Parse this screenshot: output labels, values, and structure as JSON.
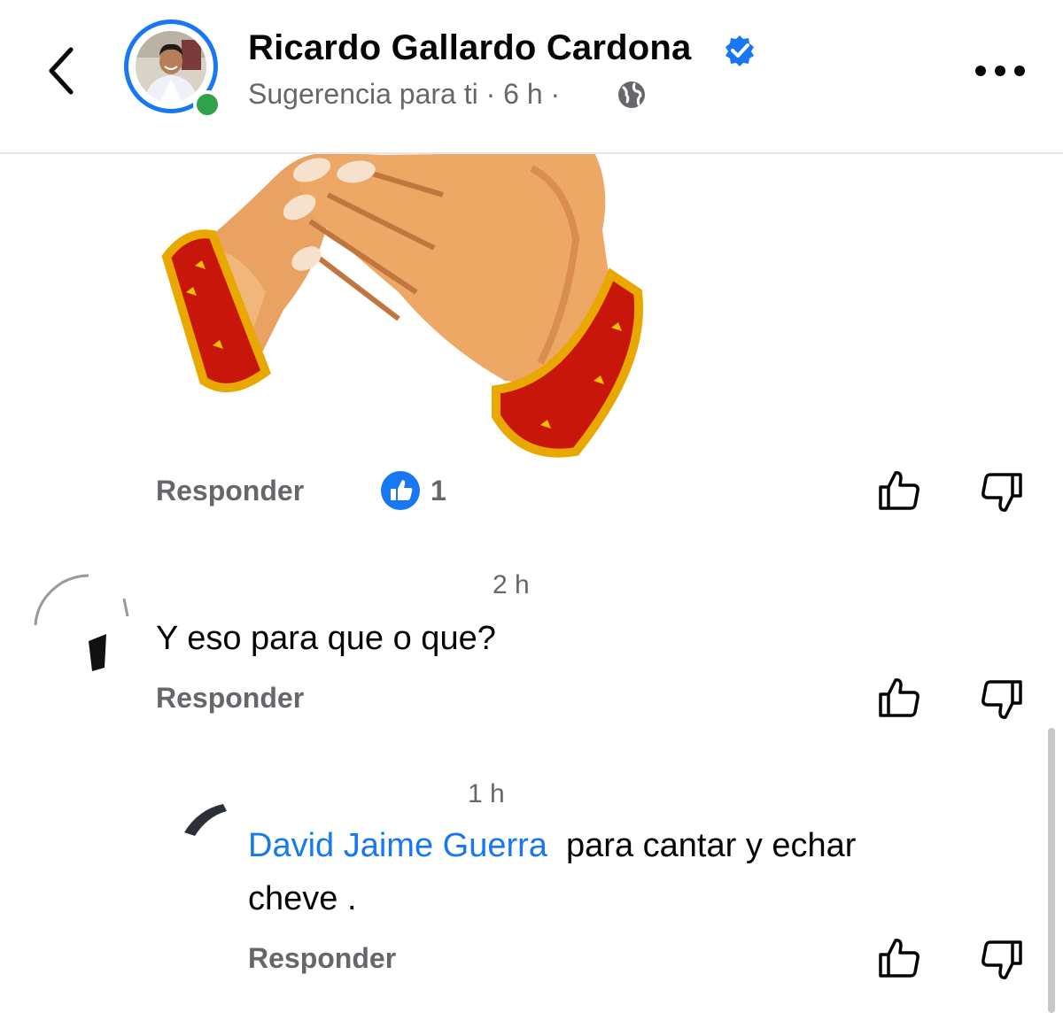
{
  "header": {
    "title": "Ricardo Gallardo Cardona",
    "subtitle_parts": [
      "Sugerencia para ti",
      "·",
      "6 h",
      "·"
    ]
  },
  "post": {
    "reply_label": "Responder",
    "reaction_count": "1"
  },
  "comments": [
    {
      "time": "2 h",
      "text": "Y eso para que o que?",
      "reply_label": "Responder"
    },
    {
      "time": "1 h",
      "mention": "David Jaime Guerra",
      "text": "para cantar y echar",
      "text_line2": "cheve .",
      "reply_label": "Responder"
    }
  ],
  "colors": {
    "accent": "#1877f2",
    "secondary_text": "#65676b",
    "online": "#31a24c"
  },
  "icons": [
    "back-icon",
    "verified-icon",
    "globe-icon",
    "more-icon",
    "like-icon",
    "thumbs-up-icon",
    "thumbs-down-icon"
  ]
}
